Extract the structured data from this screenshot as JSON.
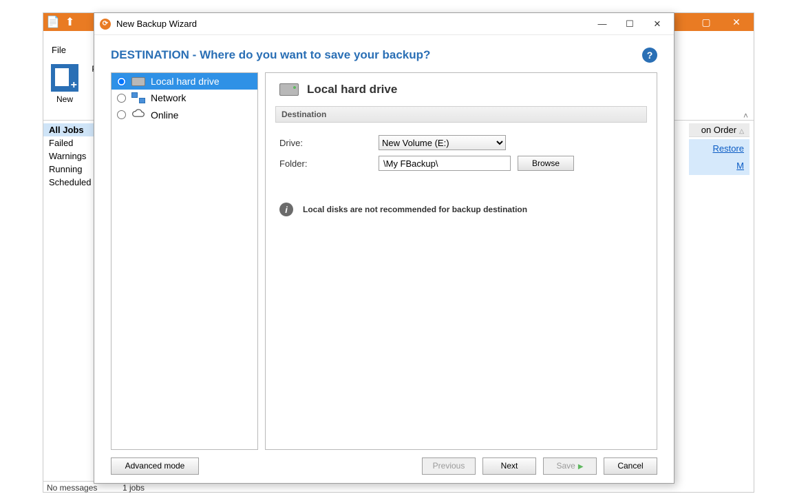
{
  "app": {
    "qat": [
      "new-file-icon",
      "up-arrow-icon"
    ],
    "file_tab": "File",
    "ribbon": {
      "new_label": "New",
      "prop_label": "Prop"
    },
    "sidebar": {
      "items": [
        {
          "label": "All Jobs",
          "active": true
        },
        {
          "label": "Failed"
        },
        {
          "label": "Warnings"
        },
        {
          "label": "Running"
        },
        {
          "label": "Scheduled"
        }
      ]
    },
    "col_header": "on Order",
    "job_row": {
      "restore": "Restore",
      "time_suffix": "M"
    },
    "status_left": "No messages",
    "status_jobs": "1 jobs"
  },
  "dialog": {
    "title": "New Backup Wizard",
    "heading": "DESTINATION - Where do you want to save your backup?",
    "dest_options": [
      {
        "key": "local",
        "label": "Local hard drive",
        "selected": true
      },
      {
        "key": "network",
        "label": "Network"
      },
      {
        "key": "online",
        "label": "Online"
      }
    ],
    "panel": {
      "title": "Local hard drive",
      "section": "Destination",
      "drive_label": "Drive:",
      "drive_value": "New Volume (E:)",
      "folder_label": "Folder:",
      "folder_value": "\\My FBackup\\",
      "browse": "Browse",
      "info": "Local disks are not recommended for backup destination"
    },
    "footer": {
      "advanced": "Advanced mode",
      "previous": "Previous",
      "next": "Next",
      "save": "Save",
      "cancel": "Cancel"
    }
  }
}
